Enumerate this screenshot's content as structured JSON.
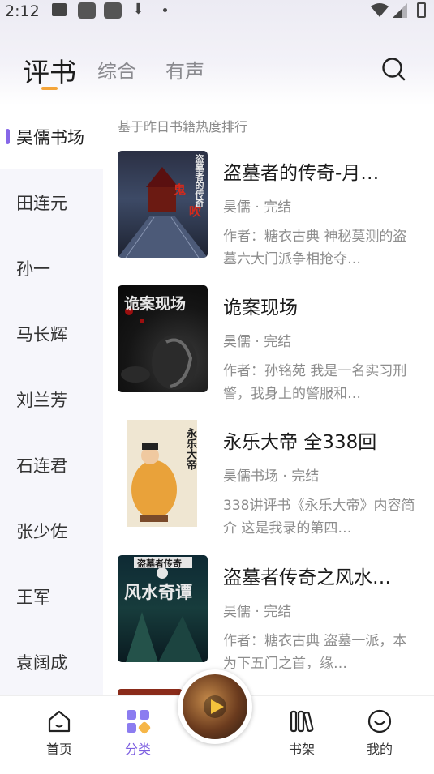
{
  "status_bar": {
    "time": "2:12"
  },
  "header": {
    "tabs": [
      {
        "label": "评书",
        "active": true
      },
      {
        "label": "综合",
        "active": false
      },
      {
        "label": "有声",
        "active": false
      }
    ],
    "search_icon": "search-icon",
    "accent_color": "#f4a53a"
  },
  "sidebar": {
    "items": [
      {
        "label": "昊儒书场",
        "active": true
      },
      {
        "label": "田连元"
      },
      {
        "label": "孙一"
      },
      {
        "label": "马长辉"
      },
      {
        "label": "刘兰芳"
      },
      {
        "label": "石连君"
      },
      {
        "label": "张少佐"
      },
      {
        "label": "王军"
      },
      {
        "label": "袁阔成"
      }
    ],
    "active_color": "#8667e8"
  },
  "content": {
    "subtitle": "基于昨日书籍热度排行",
    "books": [
      {
        "title": "盗墓者的传奇-月…",
        "meta": "昊儒 · 完结",
        "desc": "作者：糖衣古典 神秘莫测的盗墓六大门派争相抢夺…",
        "cover_text": "盗墓者的传奇"
      },
      {
        "title": "诡案现场",
        "meta": "昊儒 · 完结",
        "desc": "作者：孙铭苑 我是一名实习刑警，我身上的警服和…",
        "cover_text": "诡案现场"
      },
      {
        "title": "永乐大帝 全338回",
        "meta": "昊儒书场 · 完结",
        "desc": "338讲评书《永乐大帝》内容简介 这是我录的第四…",
        "cover_text": "永乐大帝"
      },
      {
        "title": "盗墓者传奇之风水…",
        "meta": "昊儒 · 完结",
        "desc": "作者：糖衣古典 盗墓一派，本为下五门之首，缘…",
        "cover_text": "风水奇谭",
        "cover_top_text": "盗墓者传奇"
      }
    ]
  },
  "bottom_nav": {
    "items": [
      {
        "label": "首页",
        "icon": "home-icon"
      },
      {
        "label": "分类",
        "icon": "category-icon",
        "active": true
      },
      {
        "label": "书架",
        "icon": "bookshelf-icon"
      },
      {
        "label": "我的",
        "icon": "profile-icon"
      }
    ],
    "active_color": "#7d5fe0"
  }
}
